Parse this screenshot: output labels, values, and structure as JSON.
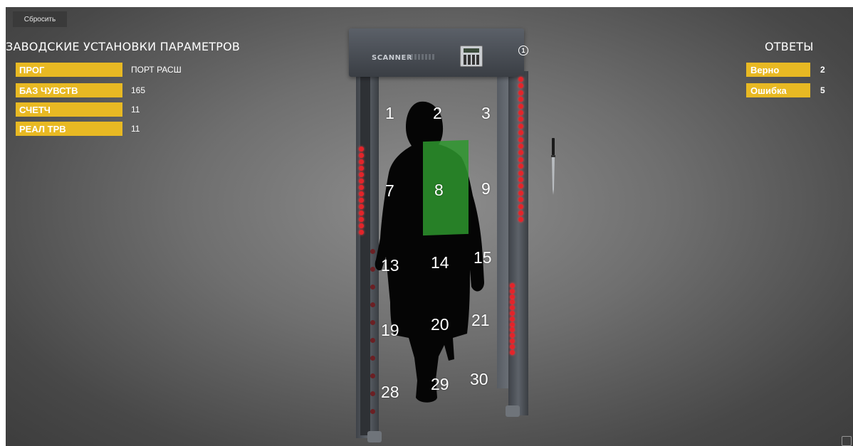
{
  "toolbar": {
    "reset_label": "Сбросить"
  },
  "settings": {
    "title": "ЗАВОДСКИЕ УСТАНОВКИ ПАРАМЕТРОВ",
    "params": [
      {
        "label": "ПРОГ",
        "value": "ПОРТ РАСШ"
      },
      {
        "label": "БАЗ ЧУВСТВ",
        "value": "165"
      },
      {
        "label": "СЧЕТЧ",
        "value": "11"
      },
      {
        "label": "РЕАЛ ТРВ",
        "value": "11"
      }
    ]
  },
  "answers": {
    "title": "ОТВЕТЫ",
    "items": [
      {
        "label": "Верно",
        "value": "2"
      },
      {
        "label": "Ошибка",
        "value": "5"
      }
    ]
  },
  "scanner": {
    "brand": "SCANNER",
    "info_label": "1",
    "active_zone": "8",
    "zones": [
      "1",
      "2",
      "3",
      "7",
      "8",
      "9",
      "13",
      "14",
      "15",
      "19",
      "20",
      "21",
      "28",
      "29",
      "30"
    ]
  },
  "colors": {
    "accent": "#e8b923",
    "active_zone": "#2e962e",
    "led": "#e4242a"
  }
}
